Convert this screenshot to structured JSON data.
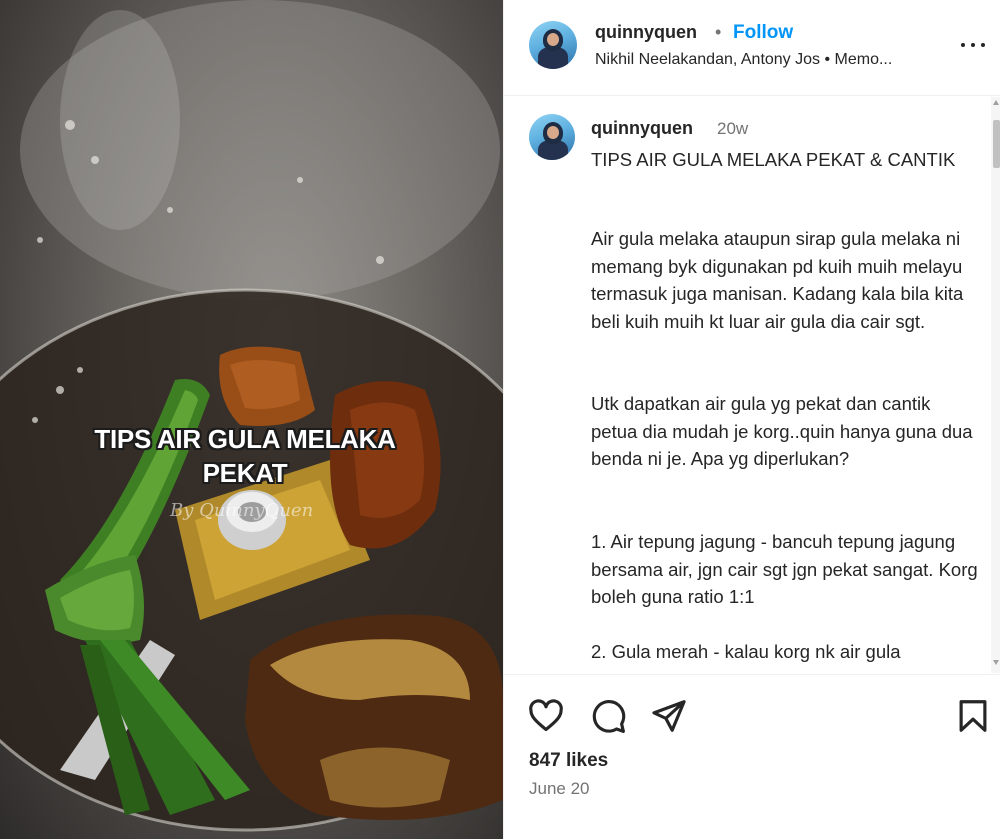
{
  "post": {
    "username": "quinnyquen",
    "follow_label": "Follow",
    "separator": "•",
    "subtitle": "Nikhil Neelakandan, Antony Jos • Memo...",
    "more_icon": "more-horizontal-icon"
  },
  "media": {
    "overlay_text_line1": "TIPS AIR GULA MELAKA",
    "overlay_text_line2": "PEKAT",
    "watermark": "By QuinnyQuen"
  },
  "caption": {
    "username": "quinnyquen",
    "time_ago": "20w",
    "title": "TIPS AIR GULA MELAKA PEKAT & CANTIK",
    "para1": "Air gula melaka ataupun sirap gula melaka ni memang byk digunakan pd kuih muih melayu termasuk juga manisan. Kadang kala bila kita beli kuih muih kt luar air gula dia cair sgt.",
    "para2": "Utk dapatkan air gula yg pekat dan cantik petua dia mudah je korg..quin hanya guna dua benda ni je. Apa yg diperlukan?",
    "para3": "1. Air tepung jagung - bancuh tepung jagung bersama air, jgn cair sgt jgn pekat sangat. Korg boleh guna ratio 1:1",
    "para4": "2. Gula merah - kalau korg nk air gula"
  },
  "actions": {
    "like_icon": "heart-icon",
    "comment_icon": "comment-icon",
    "share_icon": "send-icon",
    "save_icon": "bookmark-icon"
  },
  "stats": {
    "likes": "847 likes",
    "date": "June 20"
  },
  "colors": {
    "accent": "#0095f6",
    "text": "#262626",
    "muted": "#737373"
  }
}
